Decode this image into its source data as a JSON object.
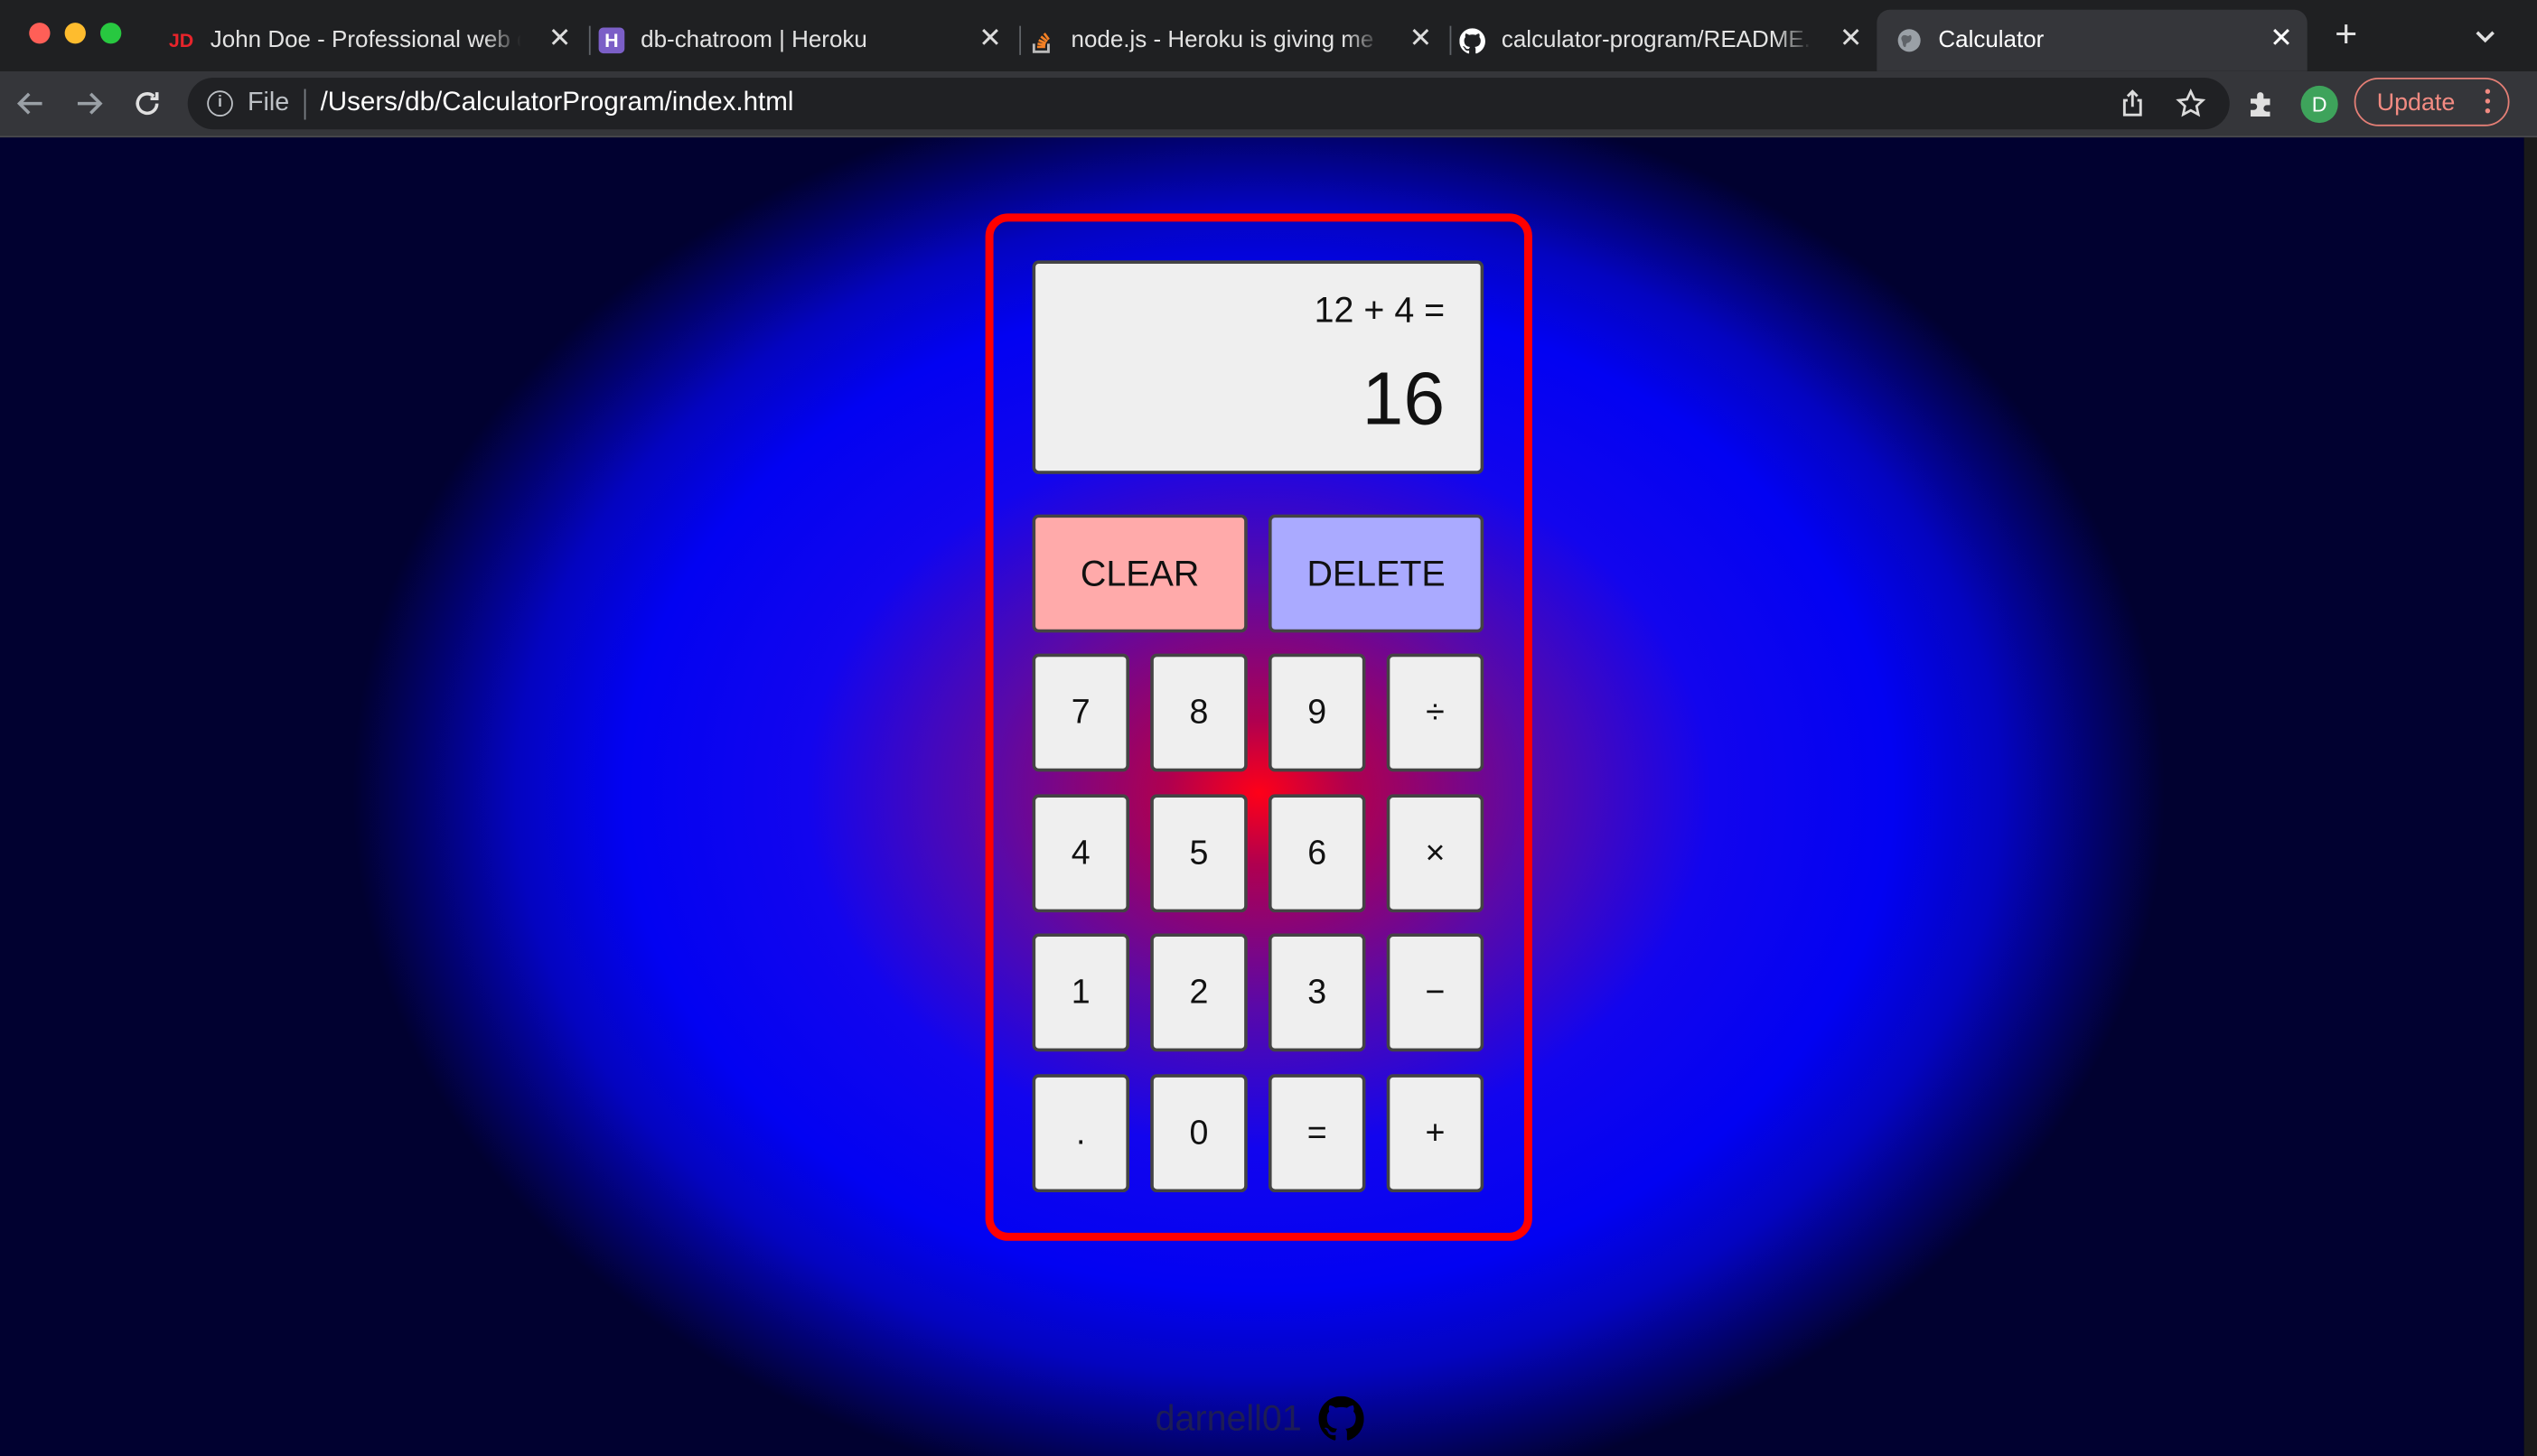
{
  "browser": {
    "tabs": [
      {
        "title": "John Doe - Professional web d",
        "favicon_text": "JD",
        "active": false
      },
      {
        "title": "db-chatroom | Heroku",
        "favicon_text": "H",
        "active": false
      },
      {
        "title": "node.js - Heroku is giving me a",
        "favicon_text": "",
        "active": false
      },
      {
        "title": "calculator-program/README.m",
        "favicon_text": "",
        "active": false
      },
      {
        "title": "Calculator",
        "favicon_text": "",
        "active": true
      }
    ],
    "new_tab_icon": "plus-icon",
    "tab_menu_icon": "chevron-down-icon",
    "address": {
      "scheme_label": "File",
      "url": "/Users/db/CalculatorProgram/index.html"
    },
    "profile_initial": "D",
    "update_label": "Update",
    "colors": {
      "accent_update": "#f28b82",
      "profile": "#3ea35b"
    }
  },
  "calculator": {
    "previous_operand": "12 + 4 =",
    "current_operand": "16",
    "clear_label": "CLEAR",
    "delete_label": "DELETE",
    "keys": [
      "7",
      "8",
      "9",
      "÷",
      "4",
      "5",
      "6",
      "×",
      "1",
      "2",
      "3",
      "−",
      ".",
      "0",
      "=",
      "+"
    ],
    "colors": {
      "clear": "#ffaaaa",
      "delete": "#aaaaff",
      "border": "#ff0000"
    }
  },
  "footer": {
    "author": "darnell01",
    "link_icon": "github-icon"
  }
}
